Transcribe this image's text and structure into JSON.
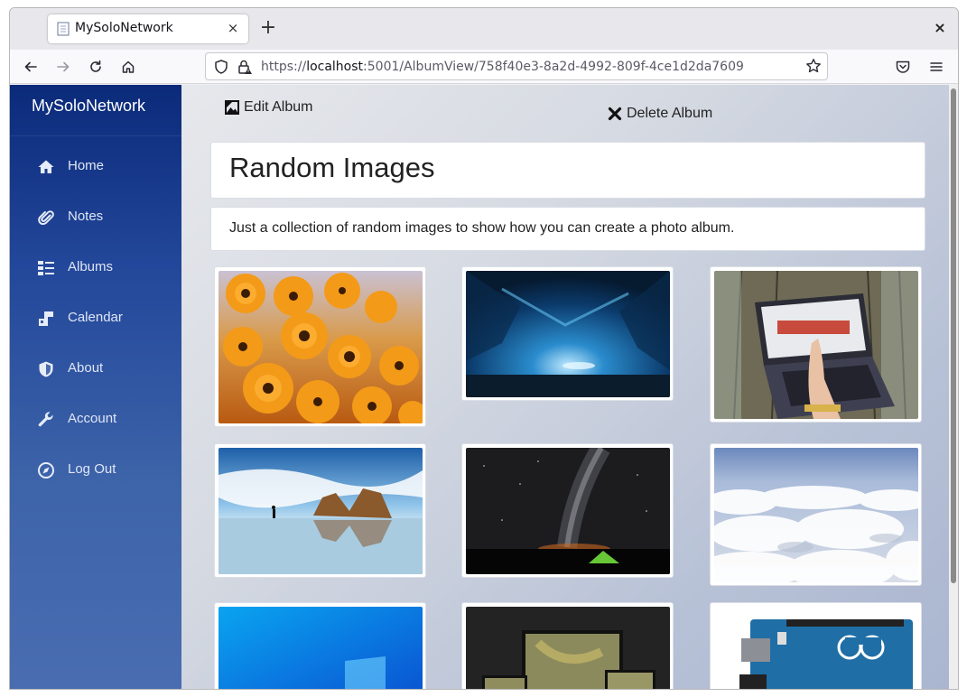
{
  "browser": {
    "tab_title": "MySoloNetwork",
    "tab_close": "×",
    "new_tab": "+",
    "window_close": "×",
    "url_prefix": "https://",
    "url_host": "localhost",
    "url_rest": ":5001/AlbumView/758f40e3-8a2d-4992-809f-4ce1d2da7609"
  },
  "sidebar": {
    "brand": "MySoloNetwork",
    "items": [
      {
        "label": "Home",
        "icon": "home-icon"
      },
      {
        "label": "Notes",
        "icon": "paperclip-icon"
      },
      {
        "label": "Albums",
        "icon": "list-icon"
      },
      {
        "label": "Calendar",
        "icon": "calendar-icon"
      },
      {
        "label": "About",
        "icon": "shield-icon"
      },
      {
        "label": "Account",
        "icon": "wrench-icon"
      },
      {
        "label": "Log Out",
        "icon": "compass-icon"
      }
    ]
  },
  "actions": {
    "edit_album": "Edit Album",
    "delete_album": "Delete Album"
  },
  "album": {
    "title": "Random Images",
    "description": "Just a collection of random images to show how you can create a photo album.",
    "images": [
      {
        "subject": "orange daisies"
      },
      {
        "subject": "blue ice cave"
      },
      {
        "subject": "hand tapping laptop touchscreen on wooden table"
      },
      {
        "subject": "rock arch on beach with reflection"
      },
      {
        "subject": "milky way over tent at night"
      },
      {
        "subject": "clouds from above"
      },
      {
        "subject": "windows blue wallpaper"
      },
      {
        "subject": "monitor, tablet and phone devices"
      },
      {
        "subject": "arduino uno board"
      }
    ]
  },
  "colors": {
    "sidebar_top": "#0b2a7a",
    "sidebar_bottom": "#4a6db1",
    "card_bg": "#ffffff"
  }
}
